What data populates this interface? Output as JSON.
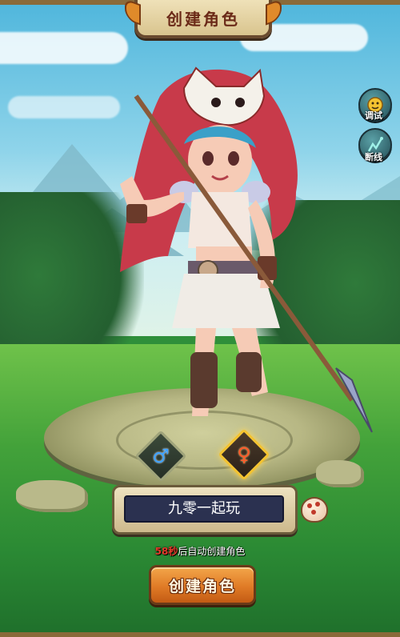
{
  "header": {
    "title": "创建角色"
  },
  "side_buttons": [
    {
      "label": "调试",
      "icon": "debug-face-icon"
    },
    {
      "label": "断线",
      "icon": "disconnect-icon"
    }
  ],
  "gender": {
    "male_symbol": "♂",
    "female_symbol": "♀",
    "selected": "female"
  },
  "name_input": {
    "value": "九零一起玩",
    "placeholder": ""
  },
  "countdown": {
    "seconds": "58秒",
    "text": "后自动创建角色"
  },
  "create_button": {
    "label": "创建角色"
  },
  "colors": {
    "accent_orange": "#e07b26",
    "selected_gold": "#f4c330",
    "input_bg": "#2b3150",
    "countdown_red": "#e23a2a"
  }
}
